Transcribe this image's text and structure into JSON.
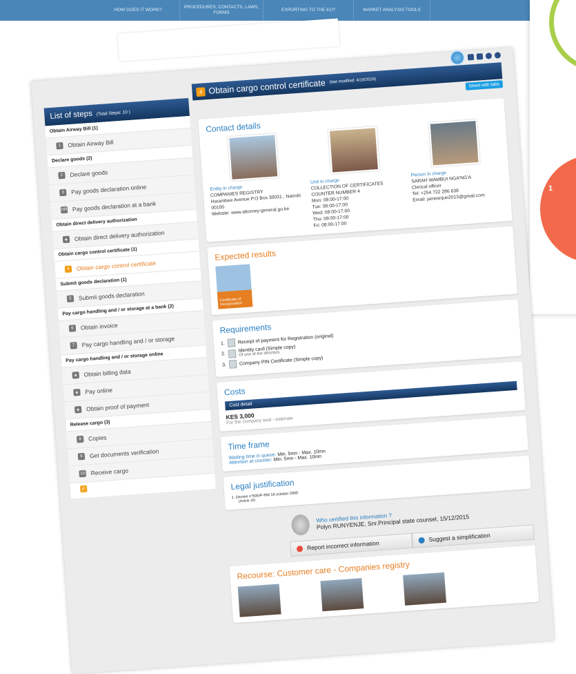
{
  "topnav": {
    "items": [
      "HOW DOES IT WORK?",
      "PROCEDURES, CONTACTS, LAWS, FORMS",
      "EXPORTING TO THE EU?",
      "MARKET ANALYSIS TOOLS"
    ]
  },
  "side_card": {
    "badge_text": "1"
  },
  "steps": {
    "title": "List of steps",
    "total": "(Total Steps: 10 )",
    "groups": [
      {
        "title": "Obtain Airway Bill (1)",
        "items": [
          {
            "num": "1",
            "label": "Obtain Airway Bill"
          }
        ]
      },
      {
        "title": "Declare goods (2)",
        "items": [
          {
            "num": "2",
            "label": "Declare goods"
          },
          {
            "num": "3",
            "label": "Pay goods declaration online"
          },
          {
            "num": "OR",
            "label": "Pay goods declaration at a bank"
          }
        ]
      },
      {
        "title": "Obtain direct delivery authorization",
        "items": [
          {
            "num": "★",
            "label": "Obtain direct delivery authorization"
          }
        ]
      },
      {
        "title": "Obtain cargo control certificate (1)",
        "items": [
          {
            "num": "4",
            "label": "Obtain cargo control certificate"
          }
        ]
      },
      {
        "title": "Submit goods declaration (1)",
        "items": [
          {
            "num": "5",
            "label": "Submit goods declaration"
          }
        ]
      },
      {
        "title": "Pay cargo handling and / or storage at a bank (2)",
        "items": [
          {
            "num": "6",
            "label": "Obtain invoice"
          },
          {
            "num": "7",
            "label": "Pay cargo handling and / or storage"
          }
        ]
      },
      {
        "title": "Pay cargo handling and / or storage online",
        "items": [
          {
            "num": "★",
            "label": "Obtain billing data"
          },
          {
            "num": "★",
            "label": "Pay online"
          },
          {
            "num": "★",
            "label": "Obtain proof of payment"
          }
        ]
      },
      {
        "title": "Release cargo (3)",
        "items": [
          {
            "num": "8",
            "label": "Copies"
          },
          {
            "num": "9",
            "label": "Get documents verification"
          },
          {
            "num": "10",
            "label": "Receive cargo"
          }
        ]
      }
    ]
  },
  "main": {
    "step_num": "4",
    "title": "Obtain cargo control certificate",
    "last_modified": "(last modified: 4/19/2016)",
    "sheet_button": "Sheet with tabs",
    "contact_details": {
      "heading": "Contact details",
      "entity": {
        "label": "Entity in charge",
        "name": "COMPANIES REGISTRY",
        "address": "Harambee Avenue P.O Box 30031 , Nairobi 00100",
        "website": "Website: www.attorney-general.go.ke"
      },
      "unit": {
        "label": "Unit in charge",
        "name": "COLLECTION OF CERTIFICATES",
        "counter": "COUNTER NUMBER 4",
        "hours": [
          "Mon:  08:00-17:00",
          "Tue:  08:00-17:00",
          "Wed:  08:00-17:00",
          "Thu:  08:00-17:00",
          "Fri:   08:00-17:00"
        ]
      },
      "person": {
        "label": "Person in charge",
        "name": "SARAH WAMBUI NGA'NG'A",
        "role": "Clerical officer",
        "tel": "Tel: +254 722 286 638",
        "email": "Email: jamesnjue2013@gmail.com"
      }
    },
    "expected_results": {
      "heading": "Expected results",
      "doc_label": "Certificate of Incorporation"
    },
    "requirements": {
      "heading": "Requirements",
      "items": [
        {
          "n": "1.",
          "text": "Receipt of payment for Registration (original)",
          "sub": ""
        },
        {
          "n": "2.",
          "text": "Identity card (Simple copy)",
          "sub": "Of one of the directors"
        },
        {
          "n": "3.",
          "text": "Company PIN Certificate (Simple copy)",
          "sub": ""
        }
      ]
    },
    "costs": {
      "heading": "Costs",
      "detail_label": "Cost detail",
      "amount": "KES 3,000",
      "note": "For the company seal - estimate"
    },
    "time_frame": {
      "heading": "Time frame",
      "queue_label": "Waiting time in queue:",
      "queue_value": "Min. 5mn - Max. 10mn",
      "counter_label": "Attention at counter:",
      "counter_value": "Min. 5mn - Max. 10mn"
    },
    "legal": {
      "heading": "Legal justification",
      "item": "1.    Decree n°505/P-RM 16 october 2000",
      "sub": "(Article 16)"
    },
    "certified": {
      "question": "Who certified this information ?",
      "who": "Polyn RUNYENJE, Snr.Principal state counsel, 15/12/2015"
    },
    "buttons": {
      "report": "Report incorrect information",
      "suggest": "Suggest a simplification"
    },
    "recourse": {
      "heading": "Recourse: Customer care - Companies registry"
    }
  }
}
